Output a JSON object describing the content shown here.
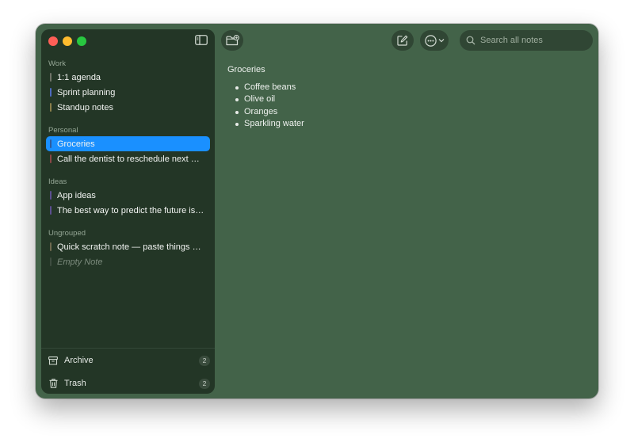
{
  "sidebar": {
    "sections": [
      {
        "header": "Work",
        "notes": [
          {
            "title": "1:1 agenda",
            "color": "#6f7468",
            "selected": false,
            "empty": false
          },
          {
            "title": "Sprint planning",
            "color": "#4d6abf",
            "selected": false,
            "empty": false
          },
          {
            "title": "Standup notes",
            "color": "#8a7f4b",
            "selected": false,
            "empty": false
          }
        ]
      },
      {
        "header": "Personal",
        "notes": [
          {
            "title": "Groceries",
            "color": "#2e5c9e",
            "selected": true,
            "empty": false
          },
          {
            "title": "Call the dentist to reschedule next week",
            "color": "#8a4747",
            "selected": false,
            "empty": false
          }
        ]
      },
      {
        "header": "Ideas",
        "notes": [
          {
            "title": "App ideas",
            "color": "#5b4f8f",
            "selected": false,
            "empty": false
          },
          {
            "title": "The best way to predict the future is to invent it",
            "color": "#5b4f8f",
            "selected": false,
            "empty": false
          }
        ]
      },
      {
        "header": "Ungrouped",
        "notes": [
          {
            "title": "Quick scratch note — paste things here",
            "color": "#6e6a4f",
            "selected": false,
            "empty": false
          },
          {
            "title": "Empty Note",
            "color": "#3e4d40",
            "selected": false,
            "empty": true
          }
        ]
      }
    ],
    "footer": {
      "archive_label": "Archive",
      "archive_count": "2",
      "trash_label": "Trash",
      "trash_count": "2"
    }
  },
  "toolbar": {
    "new_folder_icon": "folder-plus-icon",
    "compose_icon": "compose-icon",
    "more_icon": "ellipsis-circle-icon"
  },
  "search": {
    "placeholder": "Search all notes"
  },
  "editor": {
    "title": "Groceries",
    "items": [
      "Coffee beans",
      "Olive oil",
      "Oranges",
      "Sparkling water"
    ]
  },
  "colors": {
    "window_bg": "#436349",
    "sidebar_bg": "#233626",
    "selection": "#1a90ff"
  }
}
